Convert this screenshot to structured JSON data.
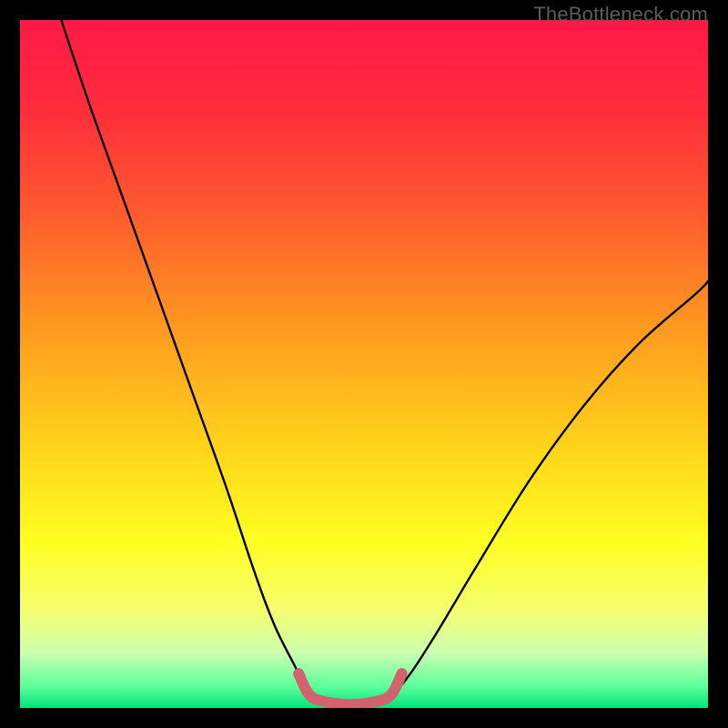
{
  "watermark": "TheBottleneck.com",
  "colors": {
    "frame": "#000000",
    "gradient_stops": [
      {
        "offset": 0.0,
        "color": "#ff1946"
      },
      {
        "offset": 0.12,
        "color": "#ff2a3d"
      },
      {
        "offset": 0.28,
        "color": "#ff5a2e"
      },
      {
        "offset": 0.45,
        "color": "#ff9a1f"
      },
      {
        "offset": 0.62,
        "color": "#ffd41a"
      },
      {
        "offset": 0.76,
        "color": "#ffff22"
      },
      {
        "offset": 0.86,
        "color": "#f3ff71"
      },
      {
        "offset": 0.92,
        "color": "#ccffb0"
      },
      {
        "offset": 0.97,
        "color": "#58ff9a"
      },
      {
        "offset": 1.0,
        "color": "#00e27a"
      }
    ],
    "curve_stroke": "#000000",
    "highlight_stroke": "#d1626e"
  },
  "chart_data": {
    "type": "line",
    "title": "",
    "xlabel": "",
    "ylabel": "",
    "xlim": [
      0,
      100
    ],
    "ylim": [
      0,
      100
    ],
    "series": [
      {
        "name": "left-branch",
        "x": [
          6,
          10,
          15,
          20,
          25,
          30,
          34,
          37,
          40,
          42,
          43
        ],
        "y": [
          100,
          88,
          74,
          60,
          46,
          32,
          20,
          12,
          6,
          2,
          1
        ]
      },
      {
        "name": "valley-floor",
        "x": [
          43,
          45,
          48,
          51,
          53
        ],
        "y": [
          1,
          0.5,
          0.5,
          0.5,
          1
        ]
      },
      {
        "name": "right-branch",
        "x": [
          53,
          56,
          60,
          66,
          74,
          82,
          90,
          98,
          100
        ],
        "y": [
          1,
          4,
          10,
          20,
          33,
          44,
          53,
          60,
          62
        ]
      },
      {
        "name": "floor-highlight",
        "x": [
          40.5,
          42,
          44,
          48,
          52,
          54,
          55.5
        ],
        "y": [
          5,
          2,
          1,
          0.5,
          1,
          2,
          5
        ]
      }
    ],
    "annotations": [
      {
        "text": "TheBottleneck.com",
        "position": "top-right"
      }
    ]
  }
}
